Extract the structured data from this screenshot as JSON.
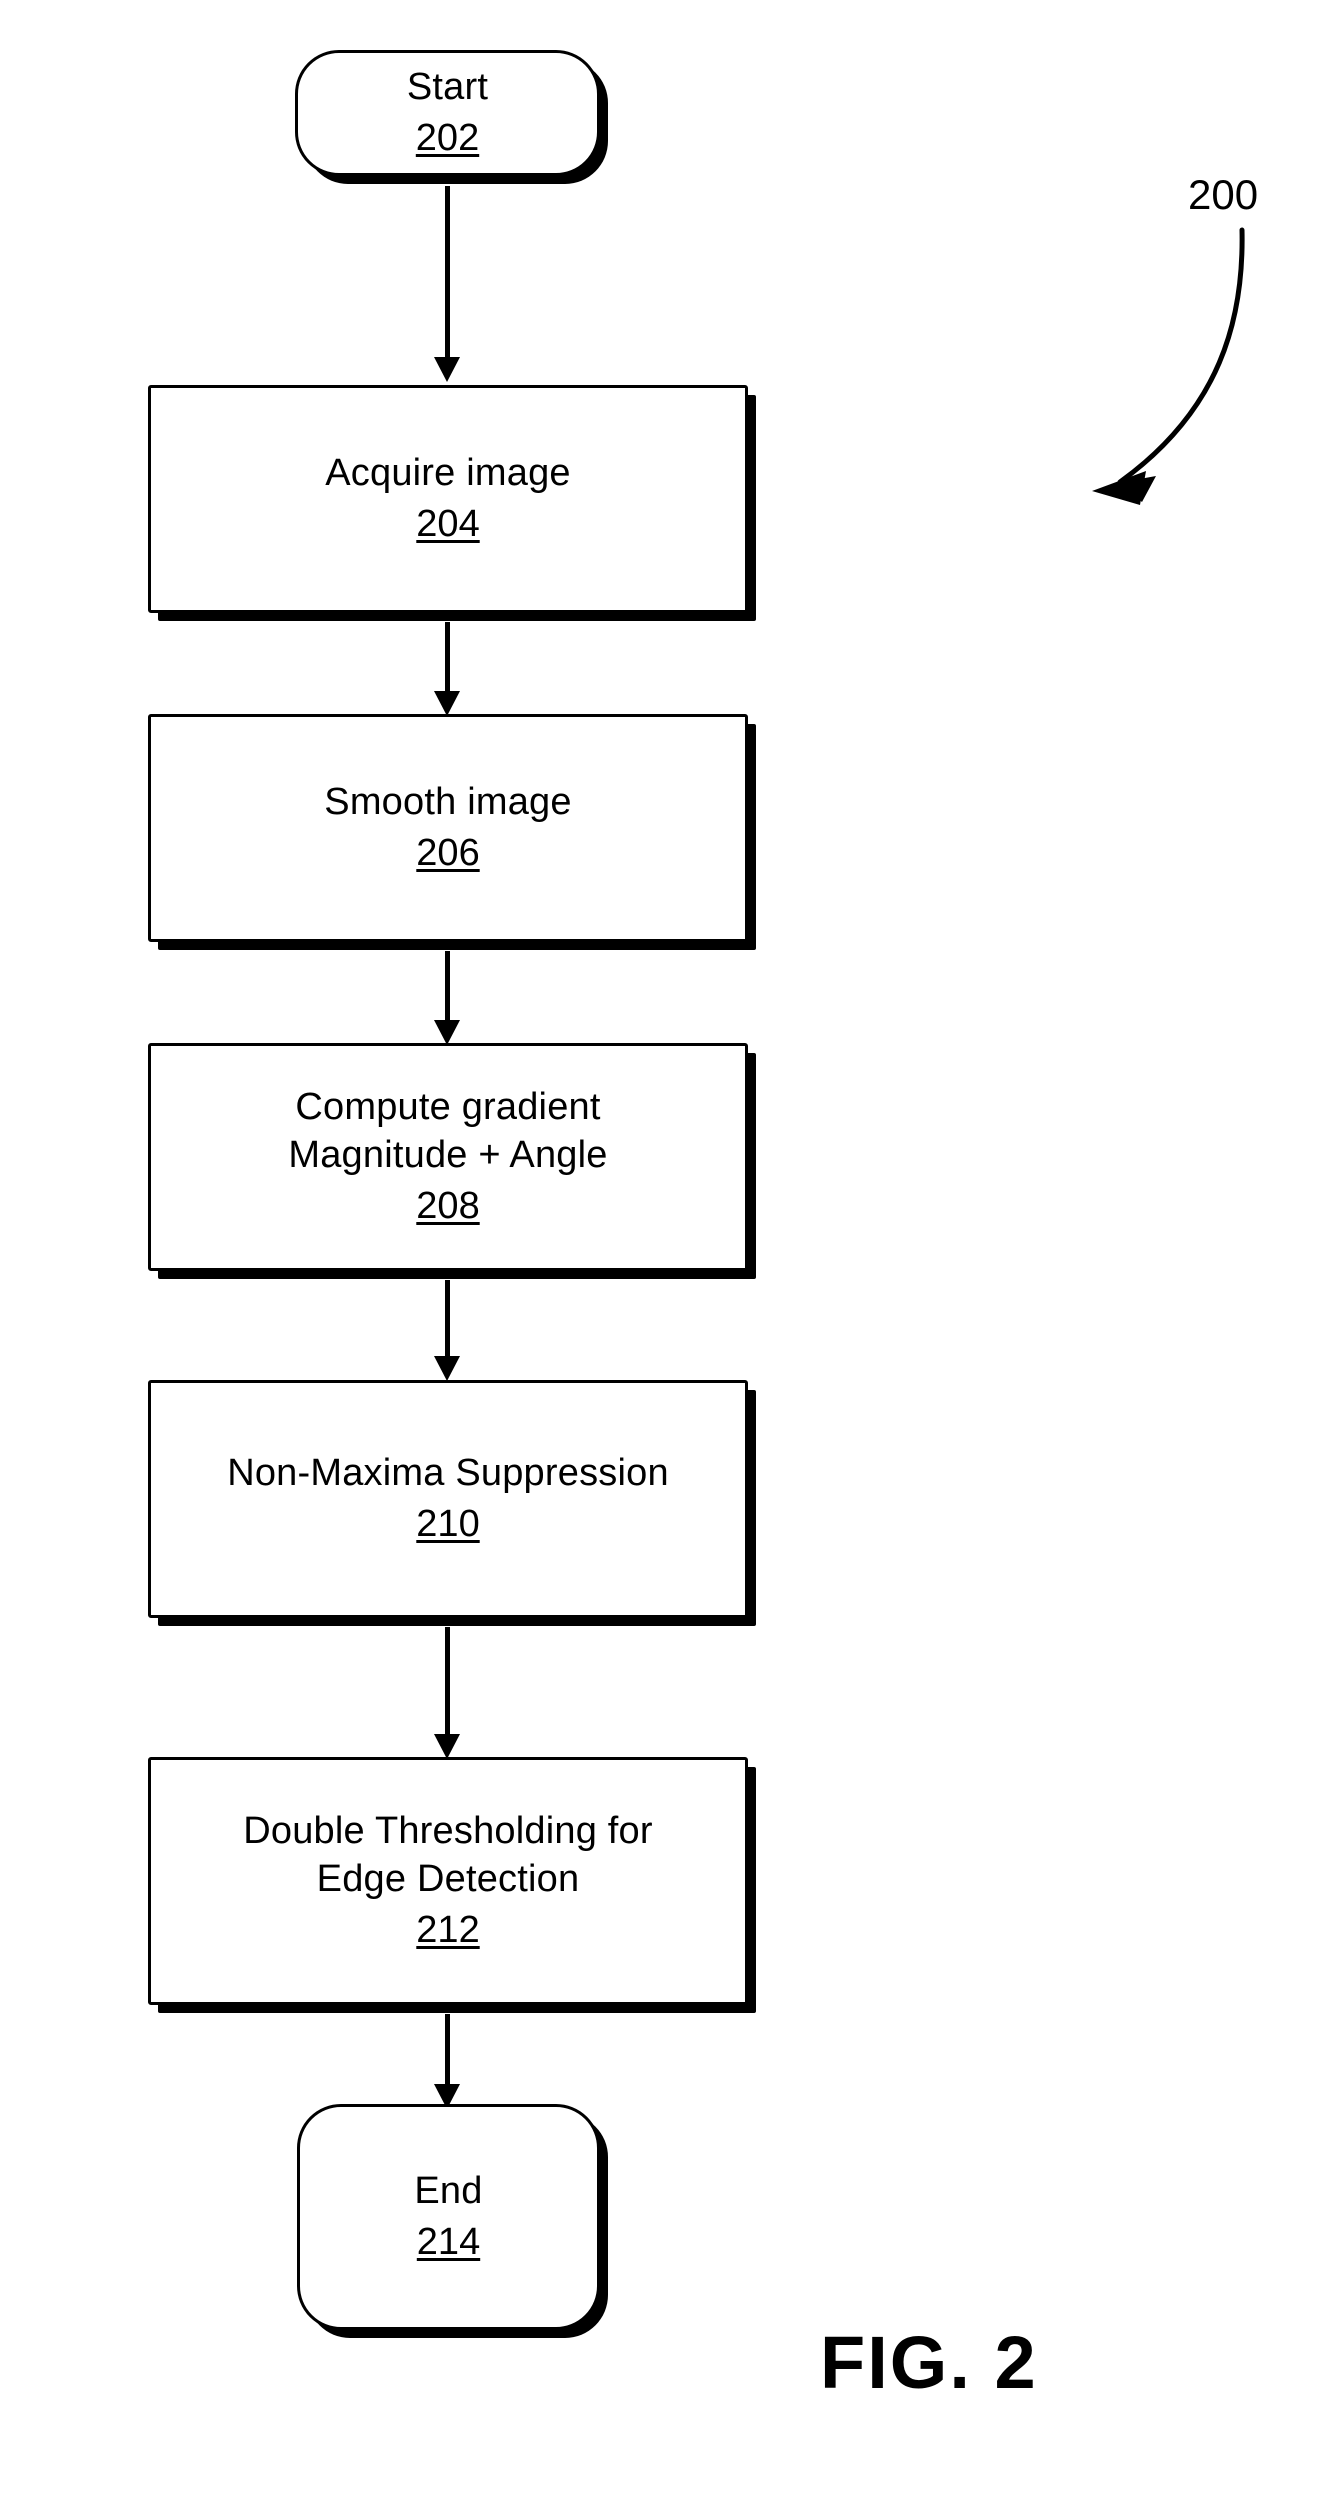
{
  "figure": {
    "caption": "FIG. 2",
    "reference_numeral": "200"
  },
  "flowchart": {
    "nodes": [
      {
        "id": "start",
        "type": "terminator",
        "label": "Start",
        "ref": "202"
      },
      {
        "id": "acquire-image",
        "type": "process",
        "label": "Acquire image",
        "ref": "204"
      },
      {
        "id": "smooth-image",
        "type": "process",
        "label": "Smooth image",
        "ref": "206"
      },
      {
        "id": "compute-gradient",
        "type": "process",
        "label": "Compute gradient",
        "label2": "Magnitude + Angle",
        "ref": "208"
      },
      {
        "id": "non-maxima-suppression",
        "type": "process",
        "label": "Non-Maxima Suppression",
        "ref": "210"
      },
      {
        "id": "double-thresholding",
        "type": "process",
        "label": "Double Thresholding for",
        "label2": "Edge Detection",
        "ref": "212"
      },
      {
        "id": "end",
        "type": "terminator",
        "label": "End",
        "ref": "214"
      }
    ]
  },
  "colors": {
    "ink": "#000000",
    "paper": "#ffffff"
  }
}
